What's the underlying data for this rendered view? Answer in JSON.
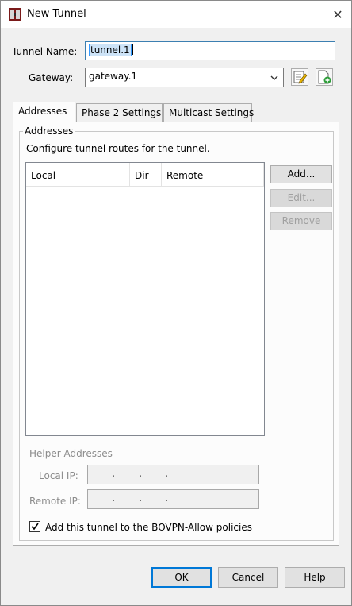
{
  "window": {
    "title": "New Tunnel",
    "close_symbol": "✕",
    "icons": {
      "app": "firebox-tunnel-icon",
      "close": "close-icon"
    }
  },
  "form": {
    "tunnel_name_label": "Tunnel Name:",
    "tunnel_name_value": "tunnel.1",
    "gateway_label": "Gateway:",
    "gateway_value": "gateway.1",
    "gateway_icons": [
      "edit-gateway-icon",
      "add-gateway-icon"
    ]
  },
  "tabs": [
    {
      "label": "Addresses",
      "active": true
    },
    {
      "label": "Phase 2 Settings",
      "active": false
    },
    {
      "label": "Multicast Settings",
      "active": false
    }
  ],
  "addresses": {
    "group_title": "Addresses",
    "description": "Configure tunnel routes for the tunnel.",
    "columns": [
      "Local",
      "Dir",
      "Remote"
    ],
    "rows": [],
    "buttons": {
      "add": "Add...",
      "edit": "Edit...",
      "remove": "Remove"
    }
  },
  "helper": {
    "title": "Helper Addresses",
    "local_ip_label": "Local IP:",
    "remote_ip_label": "Remote IP:",
    "ip_separator": "."
  },
  "policy_checkbox": {
    "label": "Add this tunnel to the BOVPN-Allow policies",
    "checked": true
  },
  "footer": {
    "ok": "OK",
    "cancel": "Cancel",
    "help": "Help"
  },
  "colors": {
    "accent": "#0078d7",
    "selection": "#cde3f7"
  }
}
